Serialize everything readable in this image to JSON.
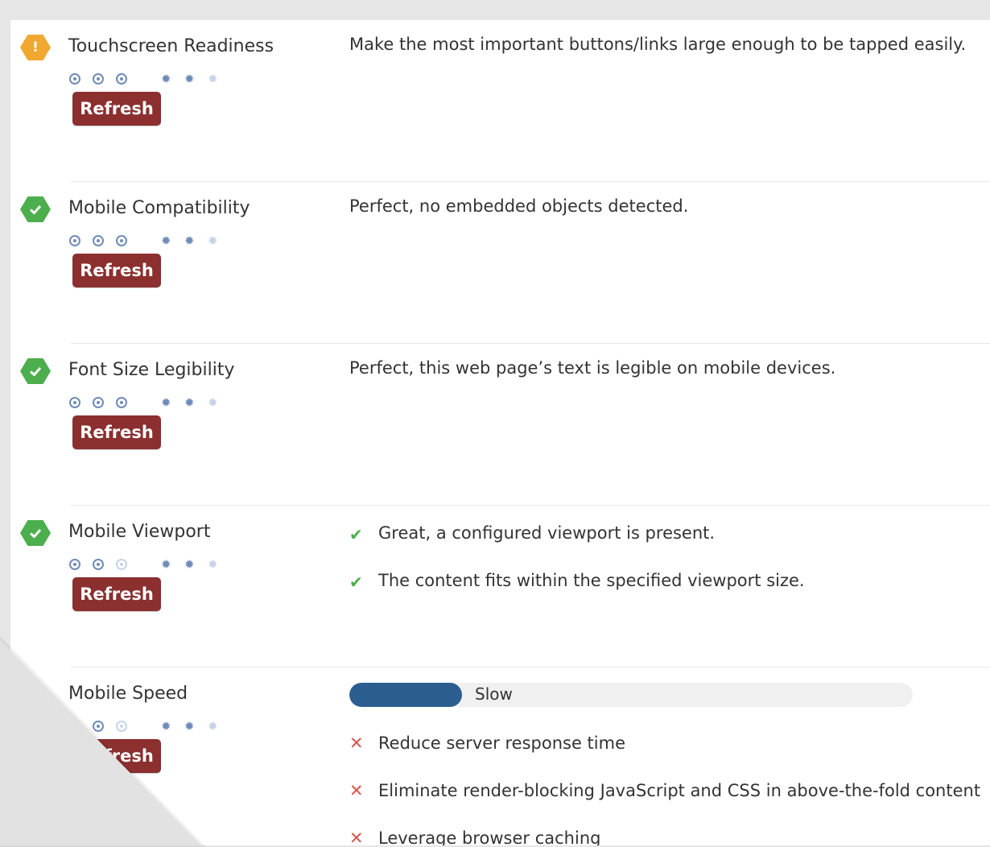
{
  "rows": [
    {
      "label": "Touchscreen Readiness",
      "status": "warning",
      "status_icon": "exclamation-icon",
      "description": "Make the most important buttons/links large enough to be tapped easily.",
      "refresh_label": "Refresh"
    },
    {
      "label": "Mobile Compatibility",
      "status": "ok",
      "status_icon": "check-icon",
      "description": "Perfect, no embedded objects detected.",
      "refresh_label": "Refresh"
    },
    {
      "label": "Font Size Legibility",
      "status": "ok",
      "status_icon": "check-icon",
      "description": "Perfect, this web page’s text is legible on mobile devices.",
      "refresh_label": "Refresh"
    },
    {
      "label": "Mobile Viewport",
      "status": "ok",
      "status_icon": "check-icon",
      "checks": [
        "Great, a configured viewport is present.",
        "The content fits within the specified viewport size."
      ],
      "refresh_label": "Refresh"
    },
    {
      "label": "Mobile Speed",
      "speed_label": "Slow",
      "speed_fraction": 0.2,
      "issues": [
        "Reduce server response time",
        "Eliminate render-blocking JavaScript and CSS in above-the-fold content",
        "Leverage browser caching"
      ],
      "refresh_label": "Refresh"
    }
  ],
  "colors": {
    "warning": "#f0a830",
    "ok": "#4cae4c",
    "refresh_button": "#8b2f2f",
    "progress_fill": "#2c5d8f",
    "fail": "#d9534f"
  }
}
